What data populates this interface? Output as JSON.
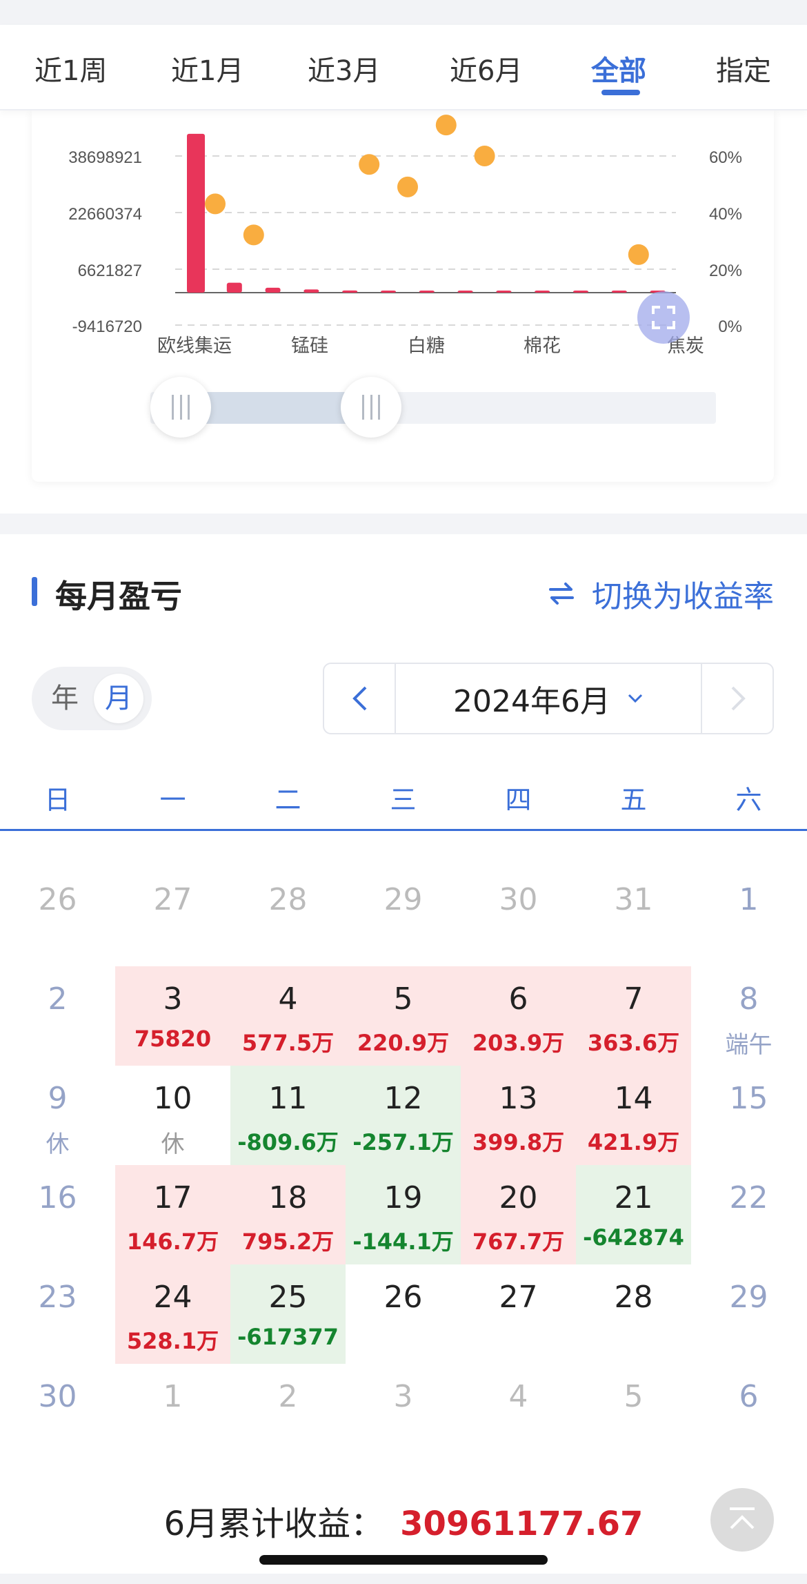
{
  "tabs": [
    {
      "label": "近1周",
      "active": false
    },
    {
      "label": "近1月",
      "active": false
    },
    {
      "label": "近3月",
      "active": false
    },
    {
      "label": "近6月",
      "active": false
    },
    {
      "label": "全部",
      "active": true
    },
    {
      "label": "指定",
      "active": false
    }
  ],
  "chart_data": {
    "type": "bar",
    "left_axis_ticks": [
      "38698921",
      "22660374",
      "6621827",
      "-9416720"
    ],
    "right_axis_ticks": [
      "60%",
      "40%",
      "20%",
      "0%"
    ],
    "x_tick_labels": [
      "欧线集运",
      "锰硅",
      "白糖",
      "棉花",
      "焦炭"
    ],
    "bars": [
      45000000,
      2800000,
      1400000,
      900000,
      600000,
      500000,
      450000,
      400000,
      350000,
      250000,
      150000,
      80000,
      40000
    ],
    "dots": [
      0.43,
      0.32,
      null,
      null,
      0.57,
      0.49,
      0.71,
      0.6,
      null,
      null,
      null,
      0.25,
      null
    ],
    "colors": {
      "bar": "#e8355a",
      "dot": "#f9ad40",
      "grid": "#d8d8d8"
    }
  },
  "monthly": {
    "title": "每月盈亏",
    "switch_label": "切换为收益率",
    "toggle": {
      "year": "年",
      "month": "月"
    },
    "month_label": "2024年6月",
    "weekdays": [
      "日",
      "一",
      "二",
      "三",
      "四",
      "五",
      "六"
    ],
    "days": [
      {
        "d": "26",
        "kind": "other"
      },
      {
        "d": "27",
        "kind": "other"
      },
      {
        "d": "28",
        "kind": "other"
      },
      {
        "d": "29",
        "kind": "other"
      },
      {
        "d": "30",
        "kind": "other"
      },
      {
        "d": "31",
        "kind": "other"
      },
      {
        "d": "1",
        "kind": "weekend"
      },
      {
        "d": "2",
        "kind": "weekend"
      },
      {
        "d": "3",
        "kind": "pos",
        "v": "75820"
      },
      {
        "d": "4",
        "kind": "pos",
        "v": "577.5万"
      },
      {
        "d": "5",
        "kind": "pos",
        "v": "220.9万"
      },
      {
        "d": "6",
        "kind": "pos",
        "v": "203.9万"
      },
      {
        "d": "7",
        "kind": "pos",
        "v": "363.6万"
      },
      {
        "d": "8",
        "kind": "weekend",
        "note": "端午"
      },
      {
        "d": "9",
        "kind": "weekend",
        "note": "休"
      },
      {
        "d": "10",
        "kind": "holiday",
        "note": "休"
      },
      {
        "d": "11",
        "kind": "neg",
        "v": "-809.6万"
      },
      {
        "d": "12",
        "kind": "neg",
        "v": "-257.1万"
      },
      {
        "d": "13",
        "kind": "pos",
        "v": "399.8万"
      },
      {
        "d": "14",
        "kind": "pos",
        "v": "421.9万"
      },
      {
        "d": "15",
        "kind": "weekend"
      },
      {
        "d": "16",
        "kind": "weekend"
      },
      {
        "d": "17",
        "kind": "pos",
        "v": "146.7万"
      },
      {
        "d": "18",
        "kind": "pos",
        "v": "795.2万"
      },
      {
        "d": "19",
        "kind": "neg",
        "v": "-144.1万"
      },
      {
        "d": "20",
        "kind": "pos",
        "v": "767.7万"
      },
      {
        "d": "21",
        "kind": "neg",
        "v": "-642874"
      },
      {
        "d": "22",
        "kind": "weekend"
      },
      {
        "d": "23",
        "kind": "weekend"
      },
      {
        "d": "24",
        "kind": "pos",
        "v": "528.1万"
      },
      {
        "d": "25",
        "kind": "neg",
        "v": "-617377"
      },
      {
        "d": "26",
        "kind": "plain"
      },
      {
        "d": "27",
        "kind": "plain"
      },
      {
        "d": "28",
        "kind": "plain"
      },
      {
        "d": "29",
        "kind": "weekend"
      },
      {
        "d": "30",
        "kind": "weekend"
      },
      {
        "d": "1",
        "kind": "other"
      },
      {
        "d": "2",
        "kind": "other"
      },
      {
        "d": "3",
        "kind": "other"
      },
      {
        "d": "4",
        "kind": "other"
      },
      {
        "d": "5",
        "kind": "other"
      },
      {
        "d": "6",
        "kind": "weekend"
      }
    ],
    "summary_label": "6月累计收益：",
    "summary_value": "30961177.67"
  },
  "icons": {
    "switch": "swap-arrows-icon",
    "prev": "chevron-left-icon",
    "next": "chevron-right-icon",
    "dropdown": "chevron-down-icon",
    "zoom": "expand-icon",
    "top": "back-to-top-icon"
  }
}
